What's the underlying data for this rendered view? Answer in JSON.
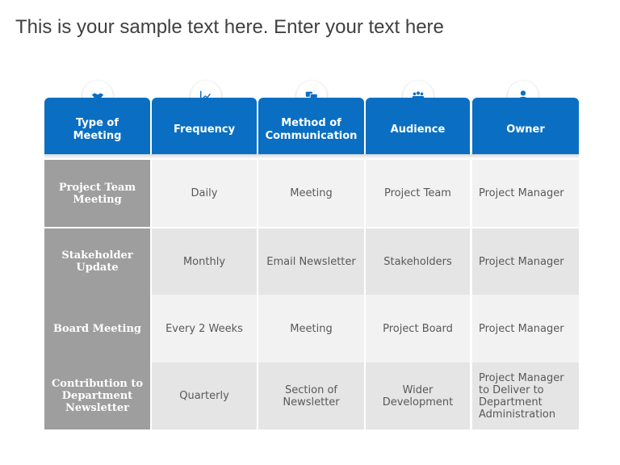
{
  "title": "This is your sample text here. Enter your text here",
  "colors": {
    "header_blue": "#0a6fc2",
    "first_col_gray": "#9e9e9e",
    "row_light": "#f2f2f2",
    "row_dark": "#e5e5e5"
  },
  "headers": [
    {
      "label": "Type of\nMeeting",
      "icon": "handshake-icon"
    },
    {
      "label": "Frequency",
      "icon": "line-chart-icon"
    },
    {
      "label": "Method of\nCommunication",
      "icon": "chat-bubbles-icon"
    },
    {
      "label": "Audience",
      "icon": "group-icon"
    },
    {
      "label": "Owner",
      "icon": "person-icon"
    }
  ],
  "rows": [
    {
      "type": "Project Team\nMeeting",
      "frequency": "Daily",
      "method": "Meeting",
      "audience": "Project Team",
      "owner": "Project Manager"
    },
    {
      "type": "Stakeholder\nUpdate",
      "frequency": "Monthly",
      "method": "Email Newsletter",
      "audience": "Stakeholders",
      "owner": "Project Manager"
    },
    {
      "type": "Board Meeting",
      "frequency": "Every 2 Weeks",
      "method": "Meeting",
      "audience": "Project Board",
      "owner": "Project Manager"
    },
    {
      "type": "Contribution to\nDepartment\nNewsletter",
      "frequency": "Quarterly",
      "method": "Section of\nNewsletter",
      "audience": "Wider\nDevelopment",
      "owner": "Project Manager\nto Deliver to\nDepartment\nAdministration"
    }
  ]
}
